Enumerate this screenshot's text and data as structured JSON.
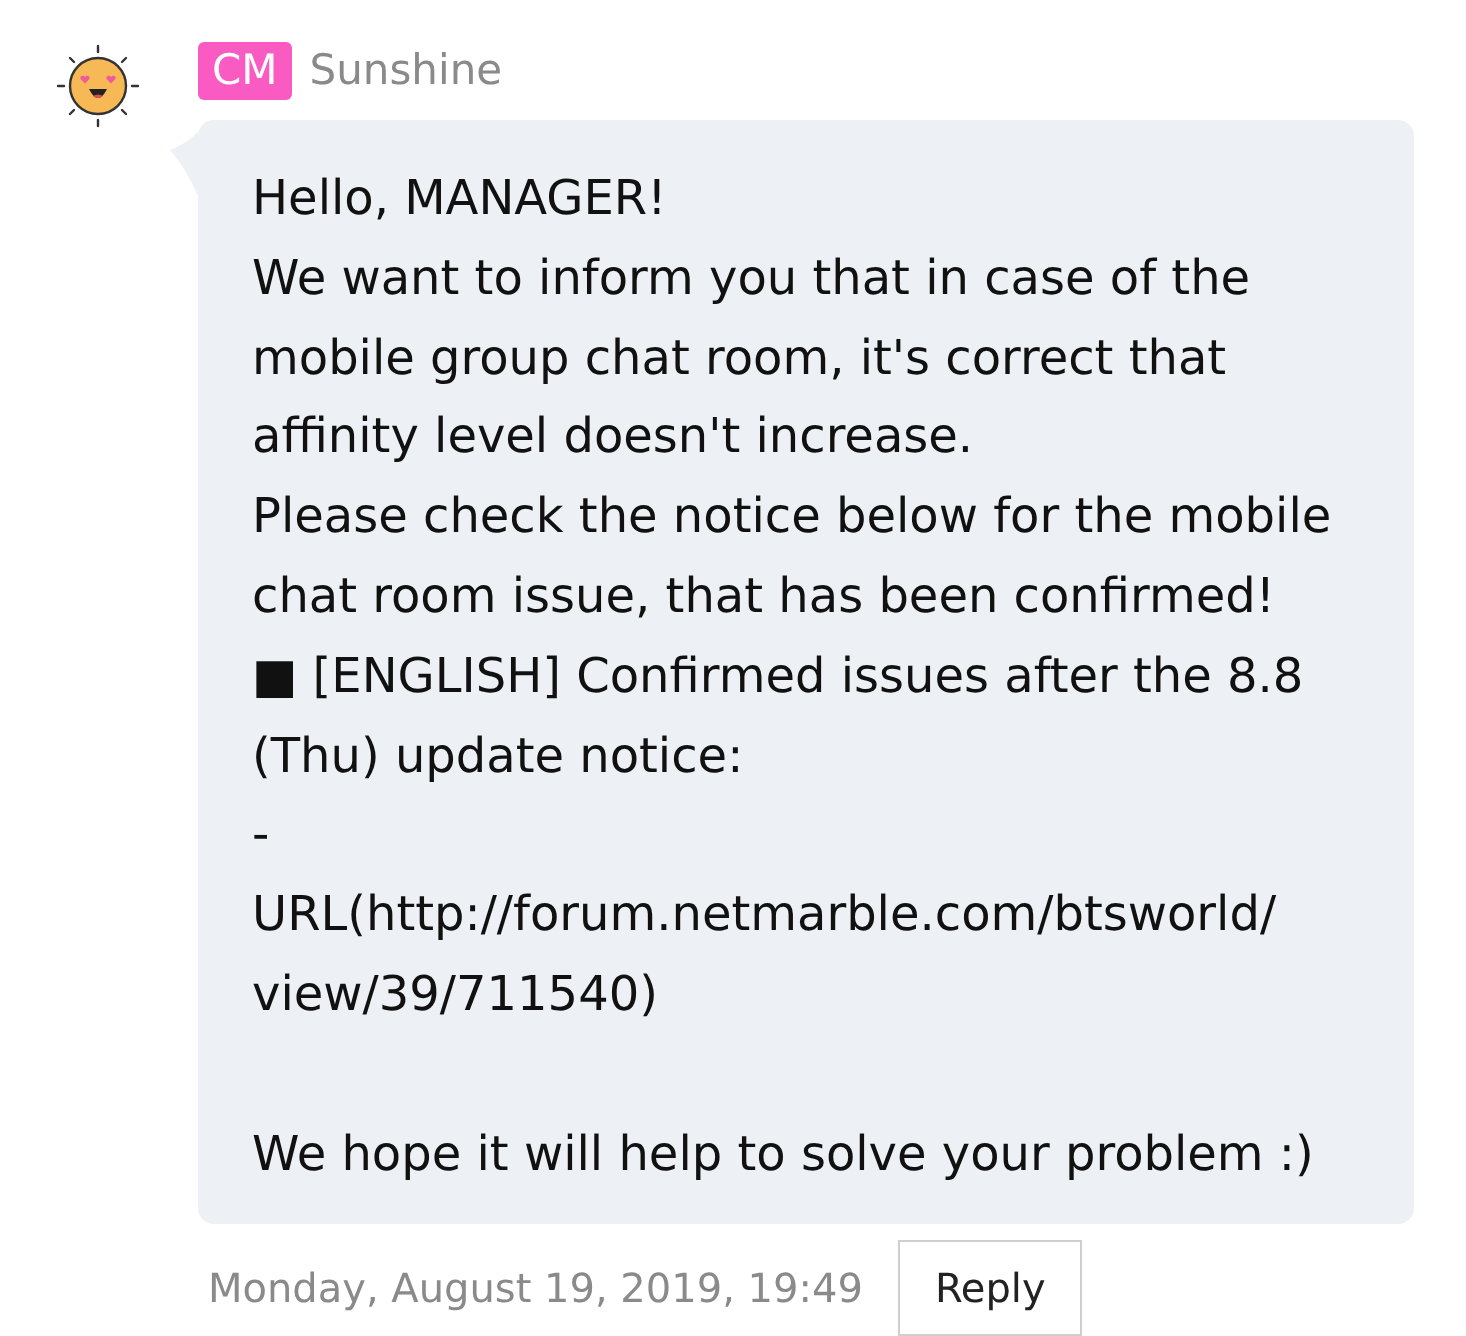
{
  "sender": {
    "badge": "CM",
    "name": "Sunshine"
  },
  "message": {
    "text": "Hello, MANAGER!\nWe want to inform you that in case of the mobile group chat room, it's correct that affinity level doesn't increase.\nPlease check the notice below for the mobile chat room issue, that has been confirmed!\n■ [ENGLISH] Confirmed issues after the 8.8 (Thu) update notice:\n-\nURL(http://forum.netmarble.com/btsworld/view/39/711540)\n\nWe hope it will help to solve your problem :)"
  },
  "footer": {
    "timestamp": "Monday, August 19, 2019, 19:49",
    "actions": [
      {
        "label": "Reply"
      }
    ]
  }
}
